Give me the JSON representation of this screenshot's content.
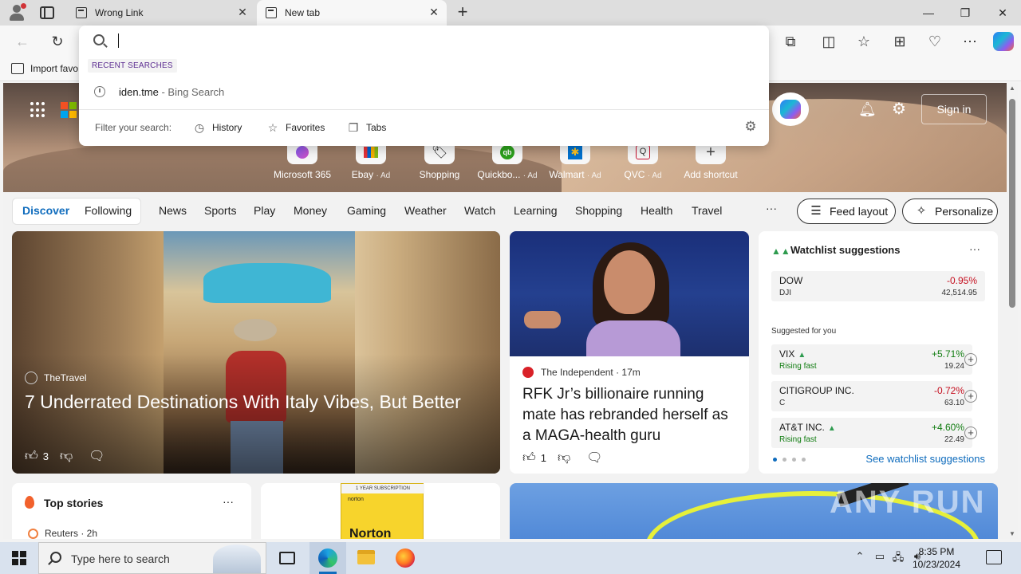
{
  "browser": {
    "tabs": [
      {
        "title": "Wrong Link",
        "close": "✕"
      },
      {
        "title": "New tab",
        "close": "✕"
      }
    ],
    "new_tab": "+",
    "window_controls": {
      "minimize": "—",
      "restore": "❐",
      "close": "✕"
    },
    "favorites_bar": {
      "import_label": "Import favo"
    }
  },
  "address_dropdown": {
    "input_value": "",
    "recent_label": "RECENT SEARCHES",
    "suggestion": {
      "query": "iden.tme",
      "suffix": " - Bing Search"
    },
    "filter_label": "Filter your search:",
    "filters": [
      "History",
      "Favorites",
      "Tabs"
    ]
  },
  "hero": {
    "sign_in": "Sign in",
    "shortcuts": [
      {
        "label": "Microsoft 365",
        "ad": ""
      },
      {
        "label": "Ebay",
        "ad": "· Ad"
      },
      {
        "label": "Shopping",
        "ad": ""
      },
      {
        "label": "Quickbo...",
        "ad": "· Ad"
      },
      {
        "label": "Walmart",
        "ad": "· Ad"
      },
      {
        "label": "QVC",
        "ad": "· Ad"
      },
      {
        "label": "Add shortcut",
        "ad": ""
      }
    ]
  },
  "feed_nav": {
    "items": [
      "Discover",
      "Following",
      "News",
      "Sports",
      "Play",
      "Money",
      "Gaming",
      "Weather",
      "Watch",
      "Learning",
      "Shopping",
      "Health",
      "Travel"
    ],
    "more": "···",
    "feed_layout": "Feed layout",
    "personalize": "Personalize"
  },
  "cards": {
    "main": {
      "source": "TheTravel",
      "headline": "7 Underrated Destinations With Italy Vibes, But Better",
      "likes": "3"
    },
    "mid": {
      "source": "The Independent · 17m",
      "headline": "RFK Jr’s billionaire running mate has rebranded herself as a MAGA-health guru",
      "likes": "1"
    },
    "top_stories": {
      "title": "Top stories",
      "more": "···",
      "source": "Reuters · 2h"
    },
    "norton": {
      "top": "1 YEAR SUBSCRIPTION",
      "brand": "norton",
      "big": "Norton"
    }
  },
  "watchlist": {
    "title": "Watchlist suggestions",
    "more": "···",
    "index": {
      "name": "DOW",
      "symbol": "DJI",
      "change": "-0.95%",
      "price": "42,514.95"
    },
    "suggested_label": "Suggested for you",
    "suggestions": [
      {
        "name": "VIX",
        "note": "Rising fast",
        "change": "+5.71%",
        "price": "19.24",
        "trend": "up"
      },
      {
        "name": "CITIGROUP INC.",
        "note": "C",
        "change": "-0.72%",
        "price": "63.10",
        "trend": "down"
      },
      {
        "name": "AT&T INC.",
        "note": "Rising fast",
        "change": "+4.60%",
        "price": "22.49",
        "trend": "up"
      }
    ],
    "see_all": "See watchlist suggestions"
  },
  "watermark": "ANY RUN",
  "taskbar": {
    "search_placeholder": "Type here to search",
    "time": "8:35 PM",
    "date": "10/23/2024"
  },
  "colors": {
    "accent": "#0f6cbd",
    "positive": "#107c10",
    "negative": "#c50f1f"
  }
}
